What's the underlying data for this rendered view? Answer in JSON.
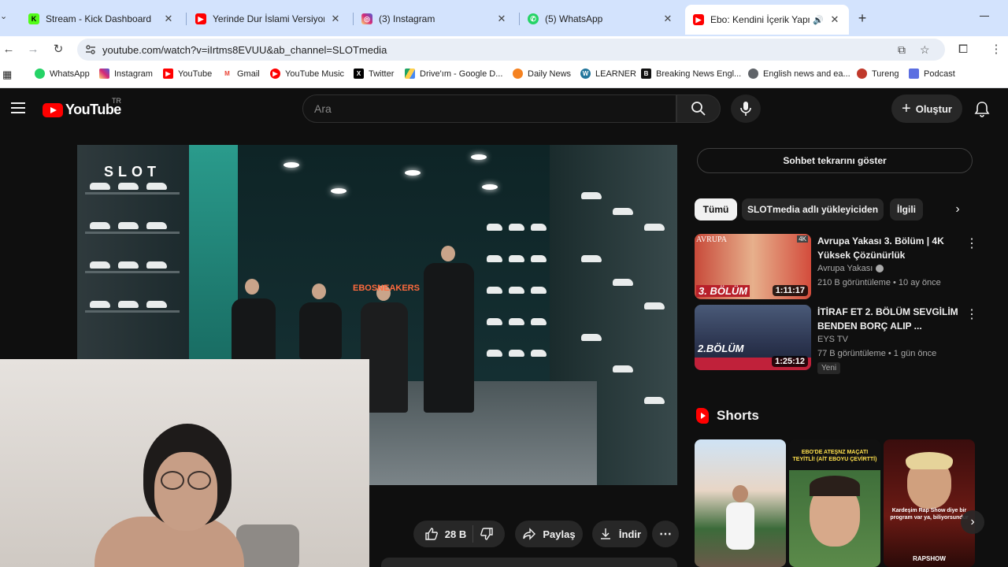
{
  "browser": {
    "tabs": [
      {
        "title": "Stream - Kick Dashboard",
        "icon": "kick-icon",
        "color": "#53fc18",
        "letter": "K"
      },
      {
        "title": "Yerinde Dur İslami Versiyon 😄",
        "icon": "youtube-icon",
        "color": "#ff0000",
        "letter": ""
      },
      {
        "title": "(3) Instagram",
        "icon": "instagram-icon",
        "color": "#d6249f",
        "letter": ""
      },
      {
        "title": "(5) WhatsApp",
        "icon": "whatsapp-icon",
        "color": "#25d366",
        "letter": ""
      },
      {
        "title": "Ebo: Kendini İçerik Yapmak",
        "icon": "youtube-icon",
        "color": "#ff0000",
        "letter": "",
        "active": true
      }
    ],
    "close_glyph": "✕",
    "new_tab_glyph": "+",
    "url": "youtube.com/watch?v=iIrtms8EVUU&ab_channel=SLOTmedia",
    "bookmarks": [
      {
        "label": "WhatsApp",
        "icon": "whatsapp-icon",
        "color": "#25d366"
      },
      {
        "label": "Instagram",
        "icon": "instagram-icon",
        "color": "#d6249f"
      },
      {
        "label": "YouTube",
        "icon": "youtube-icon",
        "color": "#ff0000"
      },
      {
        "label": "Gmail",
        "icon": "gmail-icon",
        "color": "#ea4335"
      },
      {
        "label": "YouTube Music",
        "icon": "youtube-music-icon",
        "color": "#ff0000"
      },
      {
        "label": "Twitter",
        "icon": "x-icon",
        "color": "#000000"
      },
      {
        "label": "Drive'ım - Google D...",
        "icon": "google-drive-icon",
        "color": "#1fa463"
      },
      {
        "label": "Daily News",
        "icon": "daily-news-icon",
        "color": "#f58220"
      },
      {
        "label": "LEARNER",
        "icon": "wordpress-icon",
        "color": "#21759b"
      },
      {
        "label": "Breaking News Engl...",
        "icon": "bne-icon",
        "color": "#111111"
      },
      {
        "label": "English news and ea...",
        "icon": "globe-icon",
        "color": "#5f6368"
      },
      {
        "label": "Tureng",
        "icon": "tureng-icon",
        "color": "#c0392b"
      },
      {
        "label": "Podcast",
        "icon": "podcast-icon",
        "color": "#5b6ee1"
      }
    ]
  },
  "youtube": {
    "logo_text": "YouTube",
    "country_code": "TR",
    "search_placeholder": "Ara",
    "create_label": "Oluştur",
    "player": {
      "overlay_logo": "SLOT",
      "store_sign": "EBOSNEAKERS"
    },
    "actions": {
      "likes": "28 B",
      "share": "Paylaş",
      "download": "İndir"
    },
    "chat_replay": "Sohbet tekrarını göster",
    "chips": [
      "Tümü",
      "SLOTmedia adlı yükleyiciden",
      "İlgili"
    ],
    "recommendations": [
      {
        "title": "Avrupa Yakası 3. Bölüm | 4K Yüksek Çözünürlük",
        "channel": "Avrupa Yakası",
        "verified": true,
        "meta": "210 B görüntüleme • 10 ay önce",
        "duration": "1:11:17",
        "thumb_caption": "3. BÖLÜM",
        "thumb_brand": "AVRUPA",
        "thumb_tag": "4K"
      },
      {
        "title": "İTİRAF ET  2. BÖLÜM SEVGİLİM BENDEN BORÇ ALIP ...",
        "channel": "EYS TV",
        "verified": false,
        "meta": "77 B görüntüleme • 1 gün önce",
        "duration": "1:25:12",
        "badge": "Yeni",
        "thumb_caption": "2.BÖLÜM"
      }
    ],
    "shorts": {
      "heading": "Shorts",
      "items": [
        {
          "caption": "",
          "tag": ""
        },
        {
          "caption": "EBO'DE ATEŞNZ MAÇATI TEYİTLİ! (AİT EBOYU ÇEVİRTTİ)",
          "tag": ""
        },
        {
          "caption": "Kardeşim Rap Show diye bir program var ya, biliyorsundur",
          "tag": "RAPSHOW"
        }
      ]
    }
  }
}
